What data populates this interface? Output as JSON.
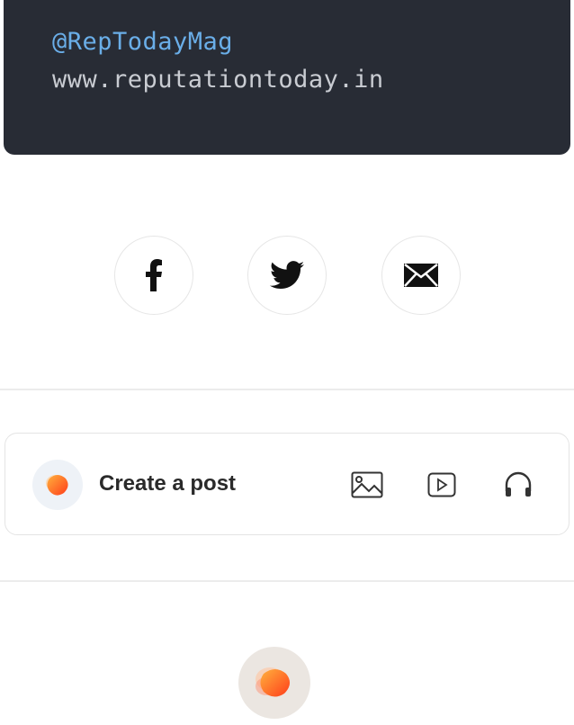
{
  "code_card": {
    "handle": "@RepTodayMag",
    "url": "www.reputationtoday.in"
  },
  "share": {
    "buttons": [
      {
        "icon": "facebook-icon"
      },
      {
        "icon": "twitter-icon"
      },
      {
        "icon": "mail-icon"
      }
    ]
  },
  "create_post": {
    "label": "Create a post",
    "icons": [
      "image-icon",
      "video-icon",
      "headphones-icon"
    ]
  },
  "colors": {
    "card_bg": "#282c35",
    "handle": "#6aaee8",
    "url": "#c9ccd2",
    "brand_orange": "#ff5a1f"
  }
}
